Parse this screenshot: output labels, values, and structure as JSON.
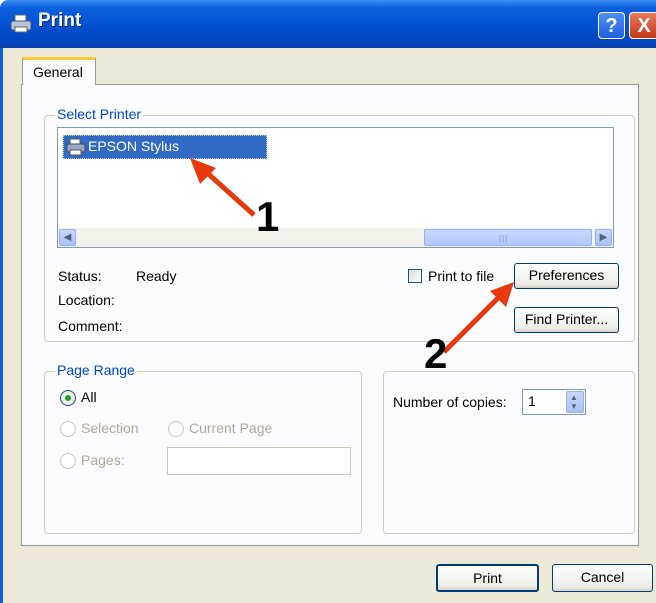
{
  "title_bar": {
    "title": "Print",
    "help_label": "?",
    "close_label": "X"
  },
  "tabs": [
    {
      "label": "General"
    }
  ],
  "select_printer": {
    "legend": "Select Printer",
    "printers": [
      {
        "name": "EPSON Stylus",
        "selected": true
      }
    ]
  },
  "printer_info": {
    "status_label": "Status:",
    "status_value": "Ready",
    "location_label": "Location:",
    "comment_label": "Comment:"
  },
  "print_to_file_label": "Print to file",
  "print_to_file_checked": false,
  "preferences_label": "Preferences",
  "find_printer_label": "Find Printer...",
  "page_range": {
    "legend": "Page Range",
    "all_label": "All",
    "selection_label": "Selection",
    "current_page_label": "Current Page",
    "pages_label": "Pages:",
    "pages_value": ""
  },
  "copies": {
    "label": "Number of copies:",
    "value": "1"
  },
  "footer": {
    "print_label": "Print",
    "cancel_label": "Cancel"
  },
  "annotations": [
    "1",
    "2"
  ],
  "colors": {
    "title_bar": "#0350d2",
    "selection": "#316ac5",
    "legend_text": "#0046d5",
    "annotation_arrow": "#e8380d"
  }
}
